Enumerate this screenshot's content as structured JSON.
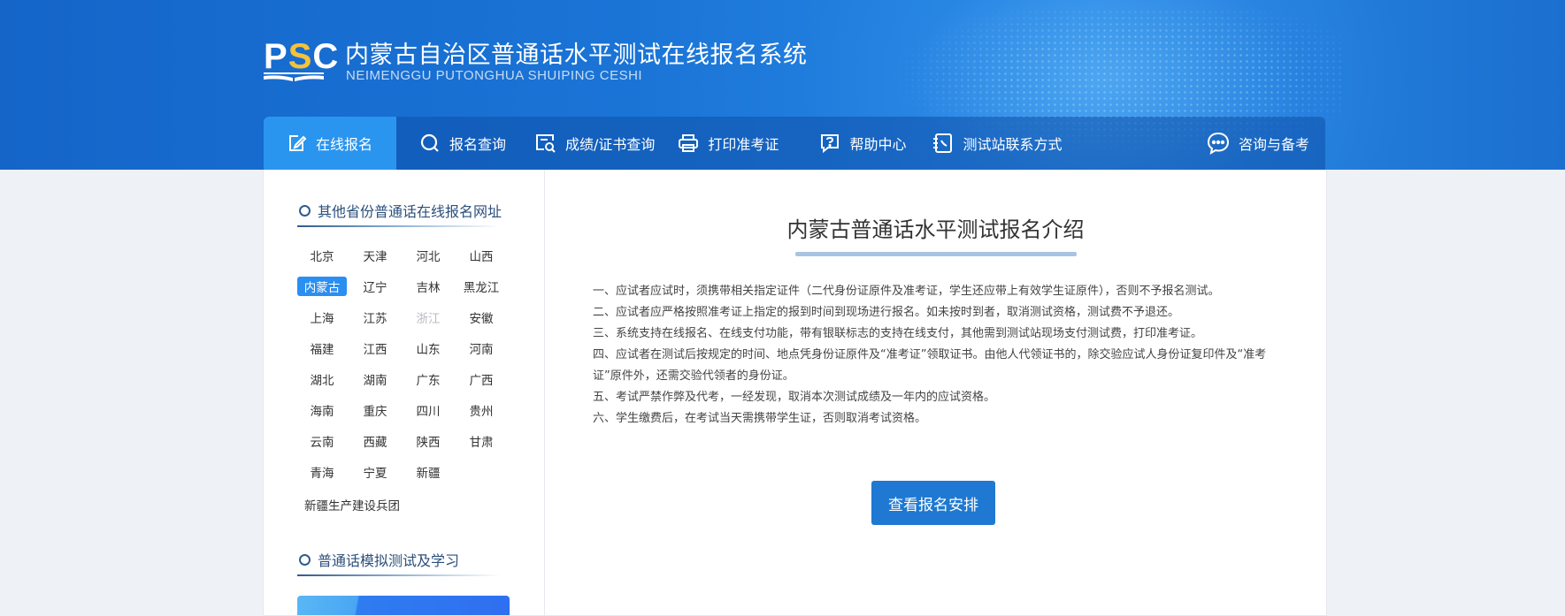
{
  "header": {
    "logo_text_p": "P",
    "logo_text_s": "S",
    "logo_text_c": "C",
    "title_cn": "内蒙古自治区普通话水平测试在线报名系统",
    "title_en": "NEIMENGGU PUTONGHUA SHUIPING CESHI"
  },
  "nav": {
    "items": [
      {
        "label": "在线报名",
        "icon": "edit-icon"
      },
      {
        "label": "报名查询",
        "icon": "search-icon"
      },
      {
        "label": "成绩/证书查询",
        "icon": "certificate-search-icon"
      },
      {
        "label": "打印准考证",
        "icon": "printer-icon"
      },
      {
        "label": "帮助中心",
        "icon": "help-icon"
      },
      {
        "label": "测试站联系方式",
        "icon": "phone-contact-icon"
      },
      {
        "label": "咨询与备考",
        "icon": "chat-icon"
      }
    ]
  },
  "sidebar": {
    "heading1": "其他省份普通话在线报名网址",
    "provinces": [
      "北京",
      "天津",
      "河北",
      "山西",
      "内蒙古",
      "辽宁",
      "吉林",
      "黑龙江",
      "上海",
      "江苏",
      "浙江",
      "安徽",
      "福建",
      "江西",
      "山东",
      "河南",
      "湖北",
      "湖南",
      "广东",
      "广西",
      "海南",
      "重庆",
      "四川",
      "贵州",
      "云南",
      "西藏",
      "陕西",
      "甘肃",
      "青海",
      "宁夏",
      "新疆"
    ],
    "active_province": "内蒙古",
    "disabled_province": "浙江",
    "extra": "新疆生产建设兵团",
    "heading2": "普通话模拟测试及学习"
  },
  "main": {
    "title": "内蒙古普通话水平测试报名介绍",
    "rules": [
      "一、应试者应试时，须携带相关指定证件（二代身份证原件及准考证，学生还应带上有效学生证原件），否则不予报名测试。",
      "二、应试者应严格按照准考证上指定的报到时间到现场进行报名。如未按时到者，取消测试资格，测试费不予退还。",
      "三、系统支持在线报名、在线支付功能，带有银联标志的支持在线支付，其他需到测试站现场支付测试费，打印准考证。",
      "四、应试者在测试后按规定的时间、地点凭身份证原件及“准考证”领取证书。由他人代领证书的，除交验应试人身份证复印件及“准考证”原件外，还需交验代领者的身份证。",
      "五、考试严禁作弊及代考，一经发现，取消本次测试成绩及一年内的应试资格。",
      "六、学生缴费后，在考试当天需携带学生证，否则取消考试资格。"
    ],
    "button": "查看报名安排"
  },
  "colors": {
    "header": "#1a74d6",
    "nav_active": "#2a95ef",
    "button": "#1f78d1",
    "province_active": "#2a8ff0"
  }
}
